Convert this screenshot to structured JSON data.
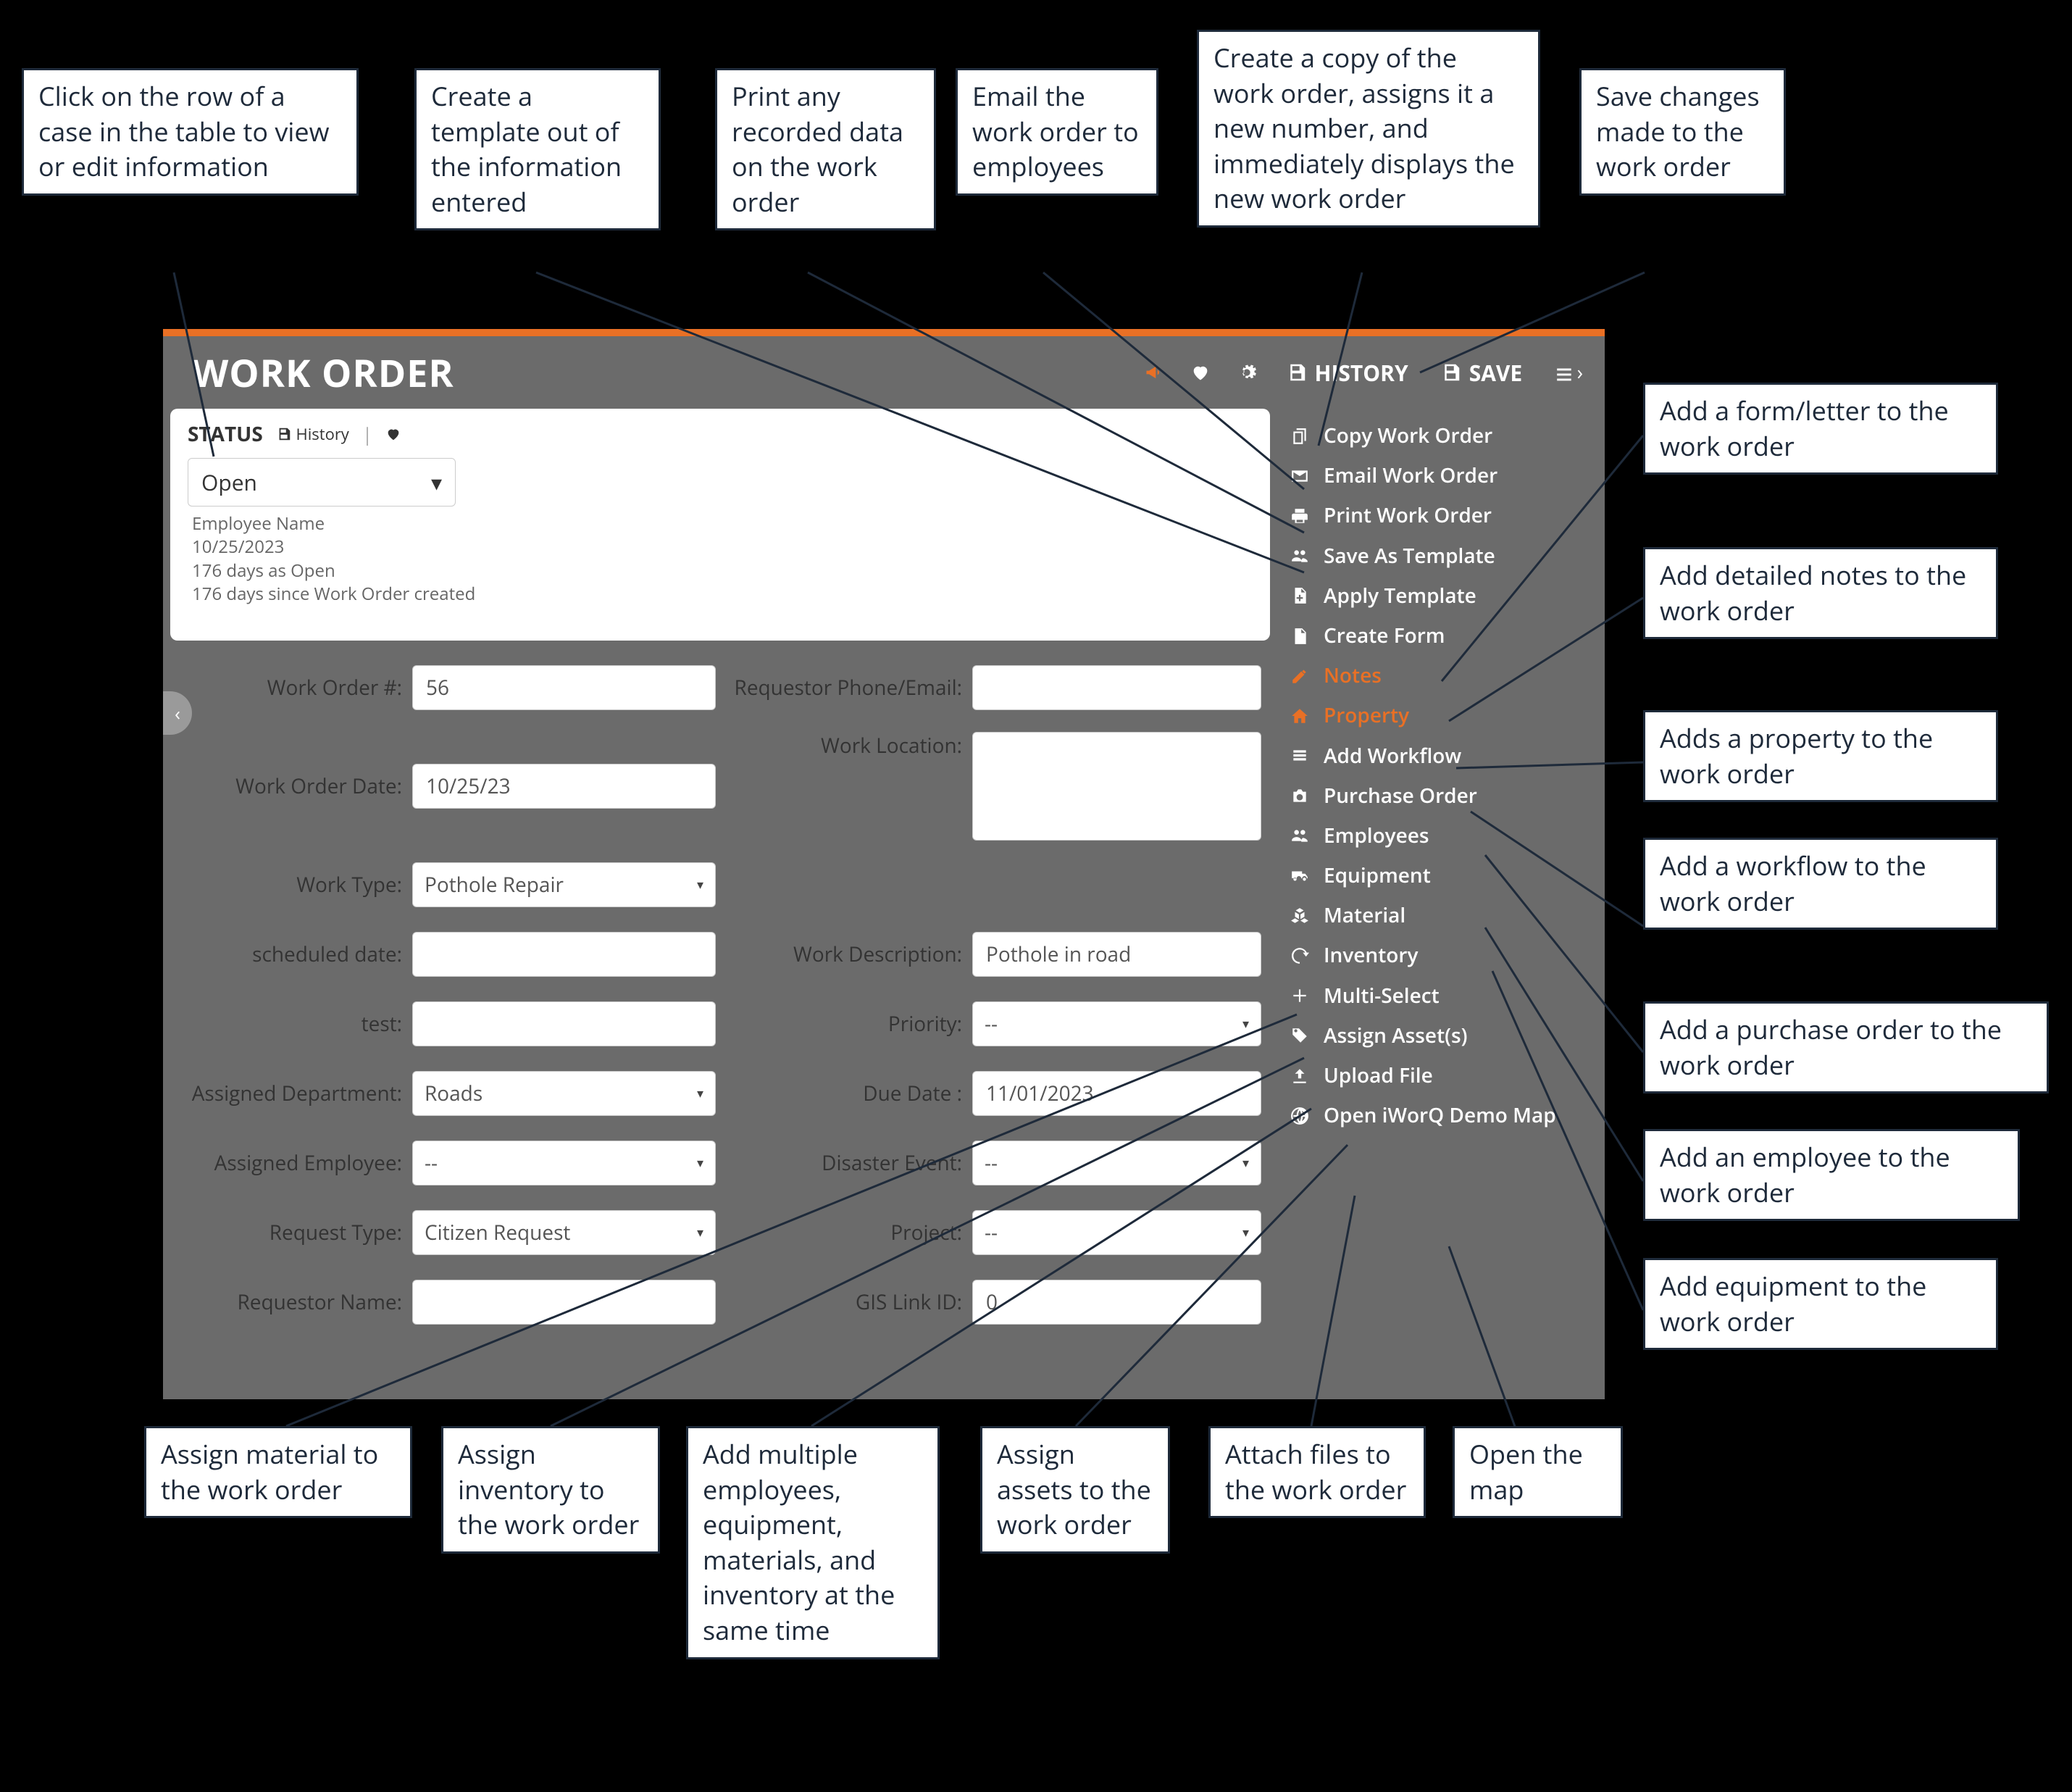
{
  "header": {
    "title": "WORK ORDER",
    "history_label": "HISTORY",
    "save_label": "SAVE"
  },
  "status_card": {
    "title": "STATUS",
    "history_label": "History",
    "status_value": "Open",
    "meta_name": "Employee Name",
    "meta_date": "10/25/2023",
    "meta_days_status": "176 days as Open",
    "meta_days_created": "176 days since Work Order created"
  },
  "form": {
    "left": [
      {
        "label": "Work Order #:",
        "value": "56",
        "type": "text"
      },
      {
        "label": "Work Order Date:",
        "value": "10/25/23",
        "type": "text"
      },
      {
        "label": "Work Type:",
        "value": "Pothole Repair",
        "type": "select"
      },
      {
        "label": "scheduled date:",
        "value": "",
        "type": "text"
      },
      {
        "label": "test:",
        "value": "",
        "type": "text"
      },
      {
        "label": "Assigned Department:",
        "value": "Roads",
        "type": "select"
      },
      {
        "label": "Assigned Employee:",
        "value": "--",
        "type": "select"
      },
      {
        "label": "Request Type:",
        "value": "Citizen Request",
        "type": "select"
      },
      {
        "label": "Requestor Name:",
        "value": "",
        "type": "text"
      }
    ],
    "right": [
      {
        "label": "Requestor Phone/Email:",
        "value": "",
        "type": "text"
      },
      {
        "label": "Work Location:",
        "value": "",
        "type": "textarea"
      },
      {
        "label": "Work Description:",
        "value": "Pothole in road",
        "type": "text"
      },
      {
        "label": "Priority:",
        "value": "--",
        "type": "select"
      },
      {
        "label": "Due Date :",
        "value": "11/01/2023",
        "type": "text"
      },
      {
        "label": "Disaster Event:",
        "value": "--",
        "type": "select"
      },
      {
        "label": "Project:",
        "value": "--",
        "type": "select"
      },
      {
        "label": "GIS Link ID:",
        "value": "0",
        "type": "text"
      }
    ]
  },
  "side_menu": [
    {
      "icon": "copy",
      "label": "Copy Work Order"
    },
    {
      "icon": "envelope",
      "label": "Email Work Order"
    },
    {
      "icon": "print",
      "label": "Print Work Order"
    },
    {
      "icon": "users",
      "label": "Save As Template"
    },
    {
      "icon": "file-add",
      "label": "Apply Template"
    },
    {
      "icon": "file",
      "label": "Create Form"
    },
    {
      "icon": "edit",
      "label": "Notes",
      "accent": true
    },
    {
      "icon": "home",
      "label": "Property",
      "accent": true
    },
    {
      "icon": "list",
      "label": "Add Workflow"
    },
    {
      "icon": "camera",
      "label": "Purchase Order"
    },
    {
      "icon": "users",
      "label": "Employees"
    },
    {
      "icon": "truck",
      "label": "Equipment"
    },
    {
      "icon": "cubes",
      "label": "Material"
    },
    {
      "icon": "refresh",
      "label": "Inventory"
    },
    {
      "icon": "plus",
      "label": "Multi-Select"
    },
    {
      "icon": "tag",
      "label": "Assign Asset(s)"
    },
    {
      "icon": "upload",
      "label": "Upload File"
    },
    {
      "icon": "globe",
      "label": "Open iWorQ Demo Map"
    }
  ],
  "callouts": {
    "row_click": "Click on the row of a case in the table to view or edit information",
    "template": "Create a template out of the information entered",
    "print": "Print any recorded data on the work order",
    "email": "Email the work order to employees",
    "copy": "Create a copy of the work order, assigns it a new number, and immediately displays the new work order",
    "save": "Save changes made to the work order",
    "form": "Add a form/letter to the work order",
    "notes": "Add detailed notes to the work order",
    "property": "Adds a property to the work order",
    "workflow": "Add a workflow to the work order",
    "po": "Add a purchase order to the work order",
    "employee": "Add an employee to the work order",
    "equipment": "Add equipment to the work order",
    "material": "Assign material to the work order",
    "inventory": "Assign inventory to the work order",
    "multi": "Add multiple employees, equipment, materials, and inventory at the same time",
    "assets": "Assign assets to the work order",
    "files": "Attach files to the work order",
    "map": "Open the map"
  }
}
